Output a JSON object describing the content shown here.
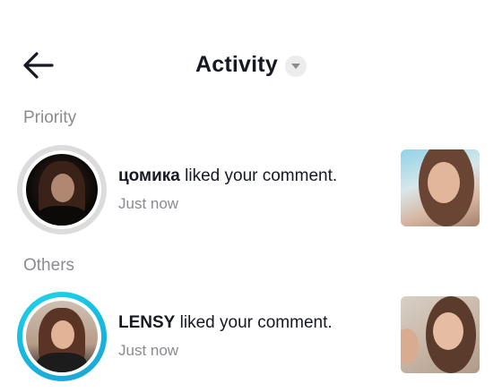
{
  "header": {
    "title": "Activity",
    "back_icon": "arrow-left-icon",
    "dropdown_icon": "caret-down-icon"
  },
  "sections": [
    {
      "label": "Priority",
      "items": [
        {
          "username": "цомика",
          "action": "liked your comment.",
          "time": "Just now"
        }
      ]
    },
    {
      "label": "Others",
      "items": [
        {
          "username": "LENSY",
          "action": "liked your comment.",
          "time": "Just now"
        }
      ]
    }
  ],
  "colors": {
    "accent_ring": "#20d5ec",
    "muted_text": "#8a8b91",
    "primary_text": "#161823"
  }
}
